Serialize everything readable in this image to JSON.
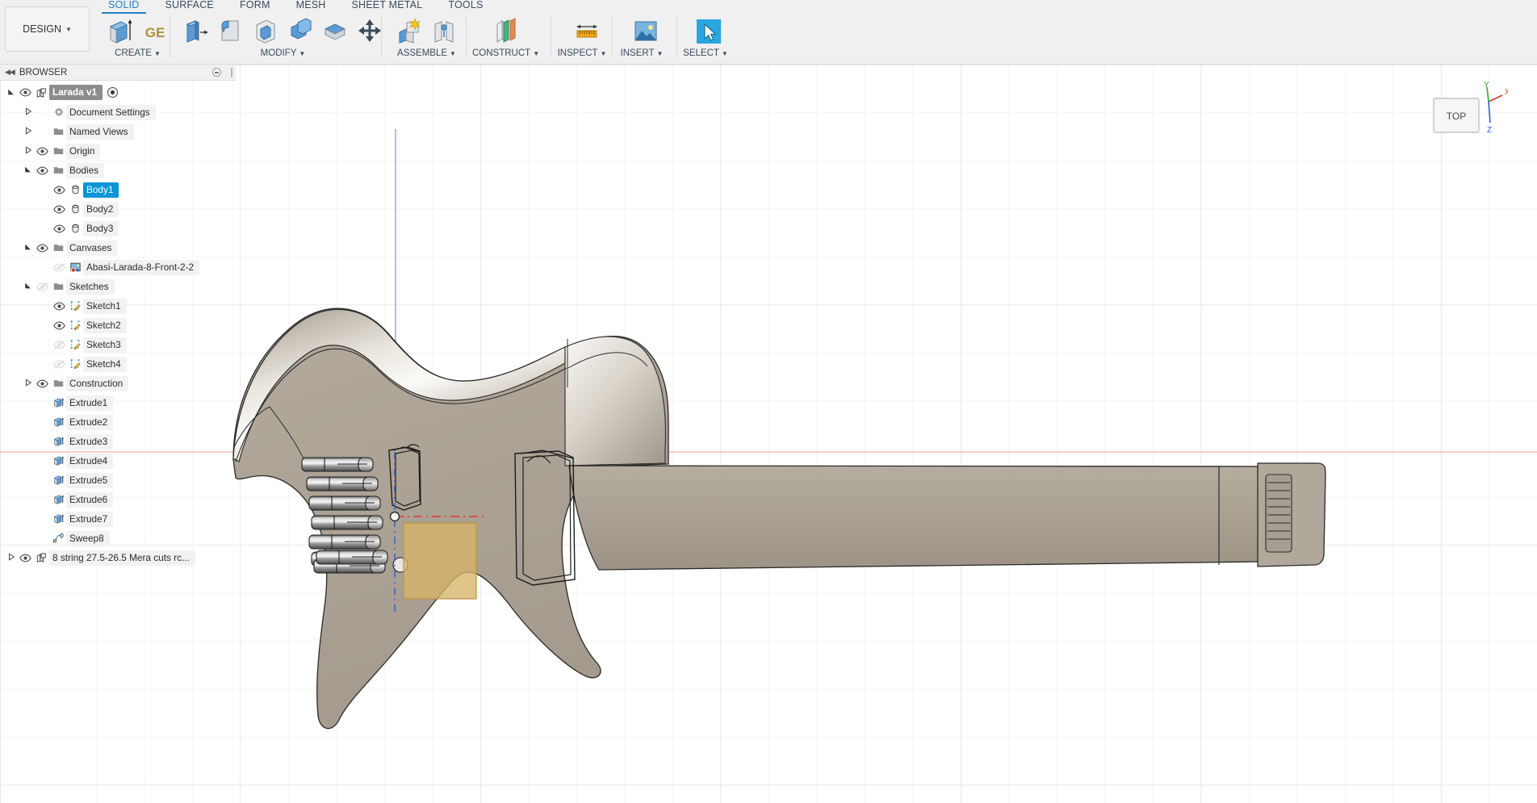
{
  "app": {
    "workspace_button": "DESIGN",
    "ribbon_tabs": [
      {
        "label": "SOLID",
        "active": true
      },
      {
        "label": "SURFACE",
        "active": false
      },
      {
        "label": "FORM",
        "active": false
      },
      {
        "label": "MESH",
        "active": false
      },
      {
        "label": "SHEET METAL",
        "active": false
      },
      {
        "label": "TOOLS",
        "active": false
      }
    ],
    "ribbon_groups": [
      {
        "label": "CREATE",
        "has_caret": true
      },
      {
        "label": "MODIFY",
        "has_caret": true
      },
      {
        "label": "ASSEMBLE",
        "has_caret": true
      },
      {
        "label": "CONSTRUCT",
        "has_caret": true
      },
      {
        "label": "INSPECT",
        "has_caret": true
      },
      {
        "label": "INSERT",
        "has_caret": true
      },
      {
        "label": "SELECT",
        "has_caret": true
      }
    ]
  },
  "browser": {
    "title": "BROWSER",
    "items": [
      {
        "label": "Larada v1",
        "indent": 0,
        "twist": "open",
        "eye": "visible",
        "icon": "component-icon",
        "style": "root",
        "radio": true
      },
      {
        "label": "Document Settings",
        "indent": 1,
        "twist": "closed",
        "eye": "none",
        "icon": "gear-icon",
        "style": "normal",
        "radio": false
      },
      {
        "label": "Named Views",
        "indent": 1,
        "twist": "closed",
        "eye": "none",
        "icon": "folder-icon",
        "style": "normal",
        "radio": false
      },
      {
        "label": "Origin",
        "indent": 1,
        "twist": "closed",
        "eye": "visible",
        "icon": "folder-icon",
        "style": "normal",
        "radio": false
      },
      {
        "label": "Bodies",
        "indent": 1,
        "twist": "open",
        "eye": "visible",
        "icon": "folder-icon",
        "style": "normal",
        "radio": false
      },
      {
        "label": "Body1",
        "indent": 2,
        "twist": "none",
        "eye": "visible",
        "icon": "body-icon",
        "style": "selected",
        "radio": false
      },
      {
        "label": "Body2",
        "indent": 2,
        "twist": "none",
        "eye": "visible",
        "icon": "body-icon",
        "style": "normal",
        "radio": false
      },
      {
        "label": "Body3",
        "indent": 2,
        "twist": "none",
        "eye": "visible",
        "icon": "body-icon",
        "style": "normal",
        "radio": false
      },
      {
        "label": "Canvases",
        "indent": 1,
        "twist": "open",
        "eye": "visible",
        "icon": "folder-icon",
        "style": "normal",
        "radio": false
      },
      {
        "label": "Abasi-Larada-8-Front-2-2",
        "indent": 2,
        "twist": "none",
        "eye": "hidden",
        "icon": "canvas-icon",
        "style": "normal",
        "radio": false
      },
      {
        "label": "Sketches",
        "indent": 1,
        "twist": "open",
        "eye": "hidden",
        "icon": "folder-icon",
        "style": "normal",
        "radio": false
      },
      {
        "label": "Sketch1",
        "indent": 2,
        "twist": "none",
        "eye": "visible",
        "icon": "sketch-icon",
        "style": "normal",
        "radio": false
      },
      {
        "label": "Sketch2",
        "indent": 2,
        "twist": "none",
        "eye": "visible",
        "icon": "sketch-icon",
        "style": "normal",
        "radio": false
      },
      {
        "label": "Sketch3",
        "indent": 2,
        "twist": "none",
        "eye": "hidden",
        "icon": "sketch-icon",
        "style": "normal",
        "radio": false
      },
      {
        "label": "Sketch4",
        "indent": 2,
        "twist": "none",
        "eye": "hidden",
        "icon": "sketch-icon",
        "style": "normal",
        "radio": false
      },
      {
        "label": "Construction",
        "indent": 1,
        "twist": "closed",
        "eye": "visible",
        "icon": "folder-icon",
        "style": "normal",
        "radio": false
      },
      {
        "label": "Extrude1",
        "indent": 1,
        "twist": "none",
        "eye": "none",
        "icon": "extrude-icon",
        "style": "normal",
        "radio": false
      },
      {
        "label": "Extrude2",
        "indent": 1,
        "twist": "none",
        "eye": "none",
        "icon": "extrude-icon",
        "style": "normal",
        "radio": false
      },
      {
        "label": "Extrude3",
        "indent": 1,
        "twist": "none",
        "eye": "none",
        "icon": "extrude-icon",
        "style": "normal",
        "radio": false
      },
      {
        "label": "Extrude4",
        "indent": 1,
        "twist": "none",
        "eye": "none",
        "icon": "extrude-icon",
        "style": "normal",
        "radio": false
      },
      {
        "label": "Extrude5",
        "indent": 1,
        "twist": "none",
        "eye": "none",
        "icon": "extrude-icon",
        "style": "normal",
        "radio": false
      },
      {
        "label": "Extrude6",
        "indent": 1,
        "twist": "none",
        "eye": "none",
        "icon": "extrude-icon",
        "style": "normal",
        "radio": false
      },
      {
        "label": "Extrude7",
        "indent": 1,
        "twist": "none",
        "eye": "none",
        "icon": "extrude-icon",
        "style": "normal",
        "radio": false
      },
      {
        "label": "Sweep8",
        "indent": 1,
        "twist": "none",
        "eye": "none",
        "icon": "sweep-icon",
        "style": "normal",
        "radio": false
      },
      {
        "label": "8 string 27.5-26.5 Mera cuts rc...",
        "indent": 0,
        "twist": "closed",
        "eye": "visible",
        "icon": "component-icon",
        "style": "normal",
        "radio": false
      }
    ]
  },
  "viewport": {
    "view_label": "TOP",
    "axis_labels": {
      "x": "X",
      "y": "Y",
      "z": "Z"
    },
    "colors": {
      "body_light": "#f2efe9",
      "body_mid": "#aaa295",
      "body_dark": "#938b7e",
      "selected_face": "#d7b368",
      "x_axis": "#e8554d",
      "y_axis": "#3b6fd4",
      "z_axis": "#3aa33a",
      "grid": "#e6e6e6",
      "background": "#ffffff"
    }
  }
}
